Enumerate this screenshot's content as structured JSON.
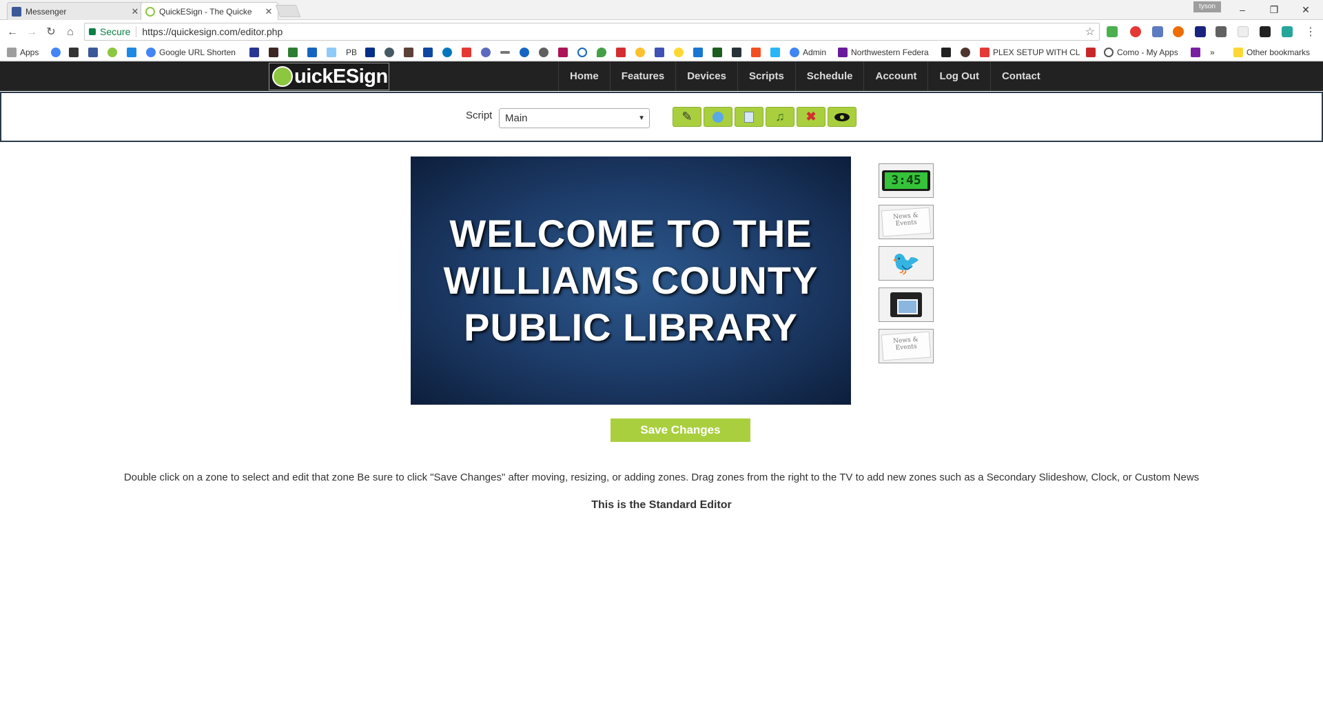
{
  "browser": {
    "tabs": [
      {
        "title": "Messenger",
        "icon": "facebook-icon"
      },
      {
        "title": "QuickESign - The Quicke",
        "icon": "quickesign-icon"
      }
    ],
    "profile_name": "tyson",
    "omnibox": {
      "secure_label": "Secure",
      "url": "https://quickesign.com/editor.php"
    },
    "bookmarks": {
      "apps_label": "Apps",
      "items": [
        "Google URL Shorten",
        "PB",
        "Admin",
        "Northwestern Federa",
        "PLEX SETUP WITH CL",
        "Como - My Apps"
      ],
      "overflow_label": "»",
      "other_label": "Other bookmarks"
    }
  },
  "site": {
    "logo_text": "uickESign",
    "nav": [
      "Home",
      "Features",
      "Devices",
      "Scripts",
      "Schedule",
      "Account",
      "Log Out",
      "Contact"
    ]
  },
  "script_bar": {
    "label": "Script",
    "selected": "Main",
    "tools": [
      "pencil-icon",
      "globe-icon",
      "copy-icon",
      "music-icon",
      "delete-icon",
      "eye-icon"
    ]
  },
  "editor": {
    "tv_text": "WELCOME TO THE WILLIAMS COUNTY PUBLIC LIBRARY",
    "zones": {
      "clock_label": "3:45",
      "news_label_1": "News & Events",
      "news_label_2": "News & Events"
    },
    "save_label": "Save Changes",
    "instructions": "Double click on a zone to select and edit that zone Be sure to click \"Save Changes\" after moving, resizing, or adding zones. Drag zones from the right to the TV to add new zones such as a Secondary Slideshow, Clock, or Custom News",
    "editor_note": "This is the Standard Editor"
  },
  "colors": {
    "accent_green": "#a9cf3f",
    "navbar": "#222222",
    "tv_blue": "#1c3a66"
  }
}
